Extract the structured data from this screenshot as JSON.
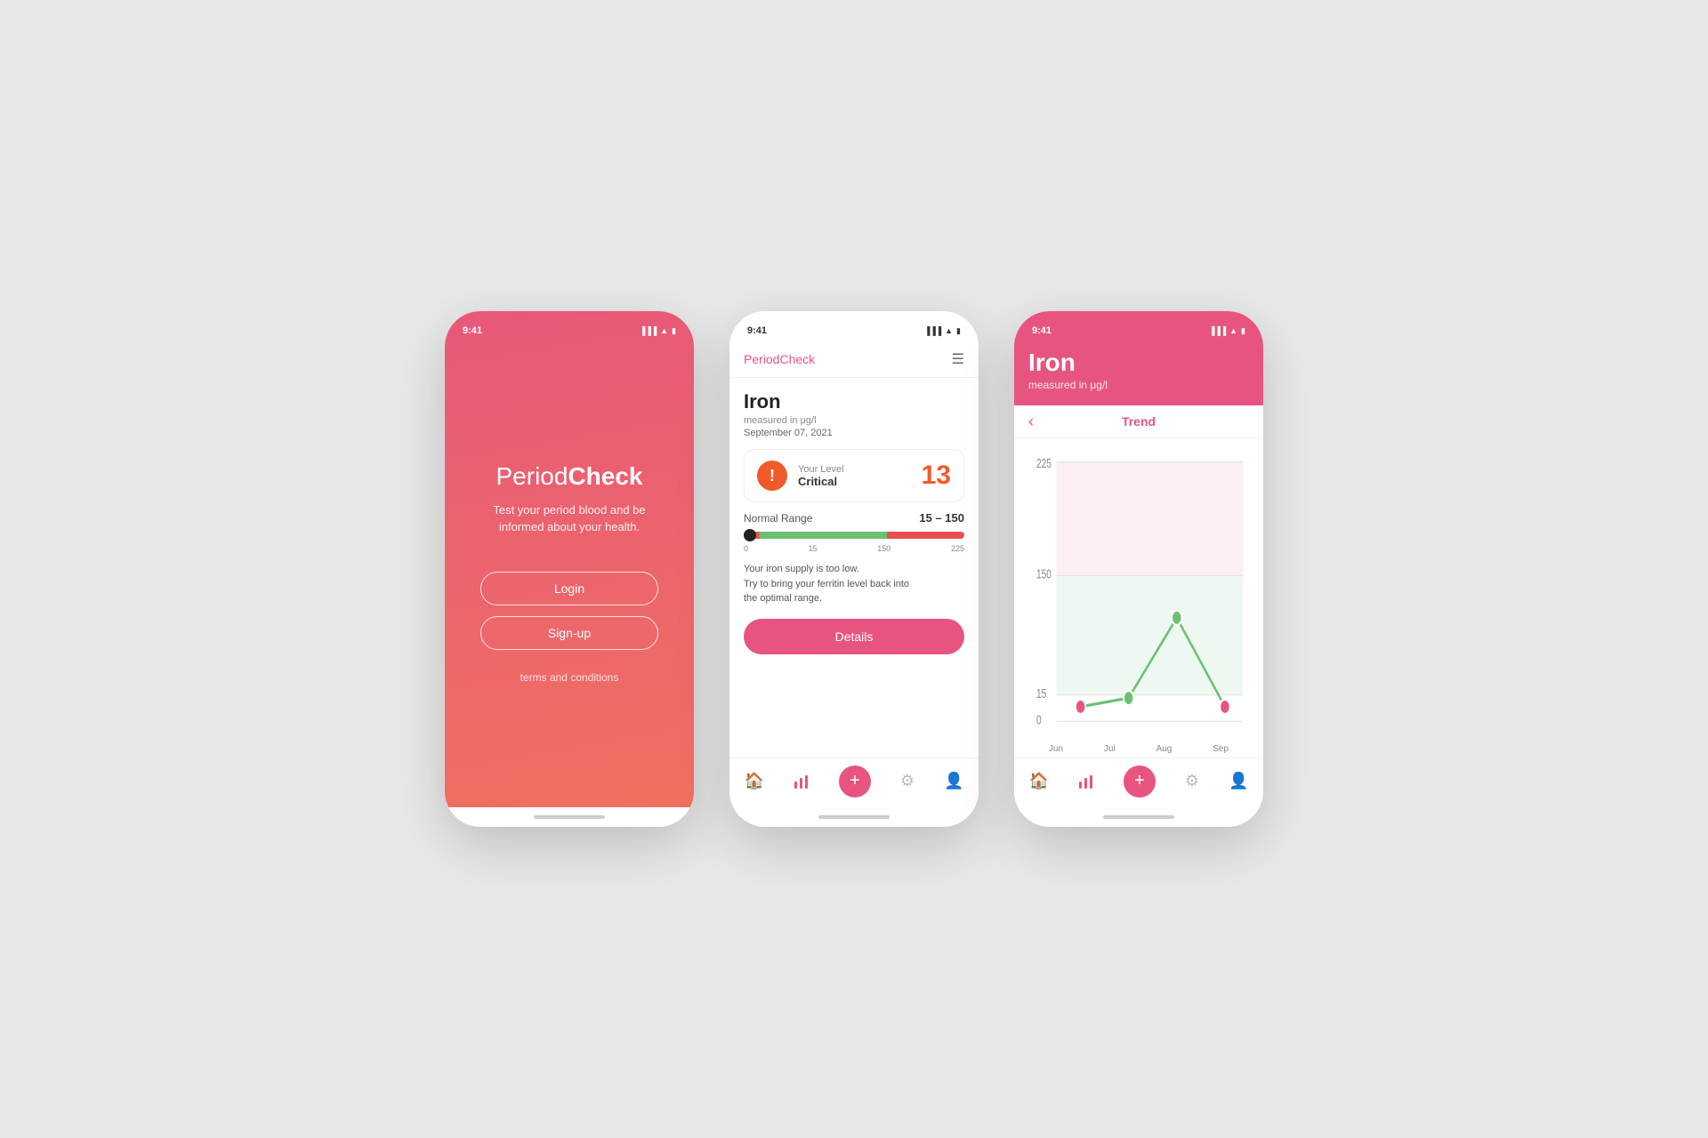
{
  "phones": {
    "phone1": {
      "time": "9:41",
      "app_name_period": "Period",
      "app_name_check": "Check",
      "subtitle": "Test your period blood and be\ninformed about your health.",
      "login_label": "Login",
      "signup_label": "Sign-up",
      "terms_label": "terms and conditions"
    },
    "phone2": {
      "time": "9:41",
      "header_title": "PeriodCheck",
      "mineral_name": "Iron",
      "mineral_unit": "measured in μg/l",
      "mineral_date": "September 07, 2021",
      "level_label": "Your Level",
      "level_status": "Critical",
      "level_value": "13",
      "normal_range_label": "Normal Range",
      "normal_range_value": "15 – 150",
      "range_marks": [
        "0",
        "15",
        "150",
        "225"
      ],
      "description": "Your iron supply is too low.\nTry to bring your ferritin level back into\nthe optimal range.",
      "details_btn": "Details",
      "nav_items": [
        "home",
        "chart",
        "add",
        "settings",
        "profile"
      ]
    },
    "phone3": {
      "time": "9:41",
      "header_title": "Iron",
      "header_subtitle": "measured in μg/l",
      "trend_title": "Trend",
      "y_labels": [
        "225",
        "150",
        "15",
        "0"
      ],
      "x_labels": [
        "Jun",
        "Jul",
        "Aug",
        "Sep"
      ],
      "nav_items": [
        "home",
        "chart",
        "add",
        "settings",
        "profile"
      ],
      "chart_data": {
        "points": [
          {
            "month": "Jun",
            "value": 13
          },
          {
            "month": "Jul",
            "value": 20
          },
          {
            "month": "Aug",
            "value": 90
          },
          {
            "month": "Sep",
            "value": 13
          }
        ],
        "normal_min": 15,
        "normal_max": 150,
        "chart_max": 225
      }
    }
  }
}
